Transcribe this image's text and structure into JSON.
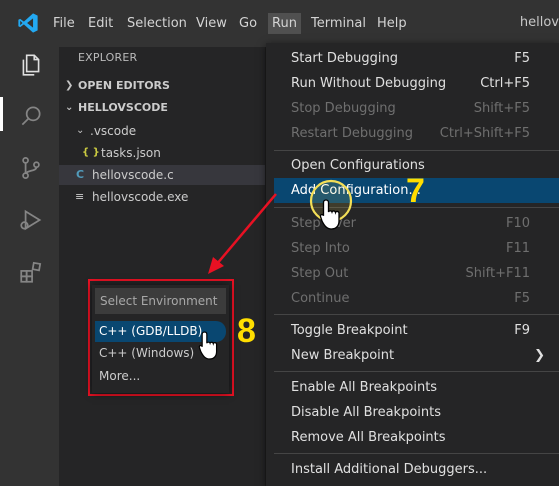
{
  "menubar": {
    "items": [
      "File",
      "Edit",
      "Selection",
      "View",
      "Go",
      "Run",
      "Terminal",
      "Help"
    ],
    "active": "Run",
    "window_title": "hellov"
  },
  "activity_bar": {
    "icons": [
      "files-icon",
      "search-icon",
      "source-control-icon",
      "run-debug-icon",
      "extensions-icon"
    ],
    "active": "files-icon"
  },
  "explorer": {
    "title": "EXPLORER",
    "open_editors": "OPEN EDITORS",
    "folder": "HELLOVSCODE",
    "vscode_folder": ".vscode",
    "tasks_file": "tasks.json",
    "c_file": "hellovscode.c",
    "exe_file": "hellovscode.exe",
    "c_icon_glyph": "C",
    "json_icon_glyph": "{ }",
    "exe_icon_glyph": "≡"
  },
  "quick_pick": {
    "placeholder": "Select Environment",
    "items": [
      "C++ (GDB/LLDB)",
      "C++ (Windows)",
      "More..."
    ],
    "selected": "C++ (GDB/LLDB)"
  },
  "run_menu": {
    "groups": [
      [
        {
          "label": "Start Debugging",
          "key": "F5",
          "enabled": true
        },
        {
          "label": "Run Without Debugging",
          "key": "Ctrl+F5",
          "enabled": true
        },
        {
          "label": "Stop Debugging",
          "key": "Shift+F5",
          "enabled": false
        },
        {
          "label": "Restart Debugging",
          "key": "Ctrl+Shift+F5",
          "enabled": false
        }
      ],
      [
        {
          "label": "Open Configurations",
          "key": "",
          "enabled": true
        },
        {
          "label": "Add Configuration...",
          "key": "",
          "enabled": true,
          "highlighted": true
        }
      ],
      [
        {
          "label": "Step Over",
          "key": "F10",
          "enabled": false
        },
        {
          "label": "Step Into",
          "key": "F11",
          "enabled": false
        },
        {
          "label": "Step Out",
          "key": "Shift+F11",
          "enabled": false
        },
        {
          "label": "Continue",
          "key": "F5",
          "enabled": false
        }
      ],
      [
        {
          "label": "Toggle Breakpoint",
          "key": "F9",
          "enabled": true
        },
        {
          "label": "New Breakpoint",
          "key": "",
          "enabled": true,
          "submenu": true
        }
      ],
      [
        {
          "label": "Enable All Breakpoints",
          "key": "",
          "enabled": true
        },
        {
          "label": "Disable All Breakpoints",
          "key": "",
          "enabled": true
        },
        {
          "label": "Remove All Breakpoints",
          "key": "",
          "enabled": true
        }
      ],
      [
        {
          "label": "Install Additional Debuggers...",
          "key": "",
          "enabled": true
        }
      ]
    ]
  },
  "annotations": {
    "step_7": "7",
    "step_8": "8",
    "accent_yellow": "#ffde00",
    "arrow_red": "#e81123"
  },
  "colors": {
    "highlight": "#094771",
    "titlebar": "#333333",
    "sidebar": "#252526",
    "vscode_blue": "#23a9f2"
  }
}
